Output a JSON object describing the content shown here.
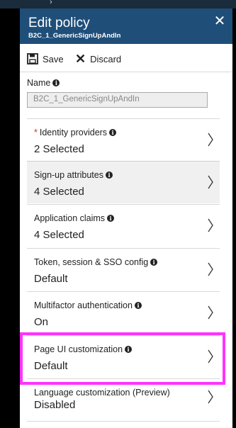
{
  "panel": {
    "title": "Edit policy",
    "subtitle": "B2C_1_GenericSignUpAndIn",
    "close_label": "✕"
  },
  "toolbar": {
    "save_label": "Save",
    "discard_label": "Discard"
  },
  "name_field": {
    "label": "Name",
    "value": "B2C_1_GenericSignUpAndIn"
  },
  "settings": [
    {
      "label": "Identity providers",
      "value": "2 Selected",
      "required": true
    },
    {
      "label": "Sign-up attributes",
      "value": "4 Selected",
      "selected": true
    },
    {
      "label": "Application claims",
      "value": "4 Selected"
    },
    {
      "label": "Token, session & SSO config",
      "value": "Default"
    },
    {
      "label": "Multifactor authentication",
      "value": "On"
    },
    {
      "label": "Page UI customization",
      "value": "Default",
      "highlighted": true
    },
    {
      "label": "Language customization (Preview)",
      "value": "Disabled"
    }
  ],
  "colors": {
    "header_bg": "#1f4e79",
    "highlight_border": "#ff33ff",
    "required_star": "#c0392b"
  },
  "icons": {
    "save": "floppy-disk-icon",
    "discard": "x-icon",
    "info": "info-icon",
    "chevron": "chevron-right-icon"
  }
}
